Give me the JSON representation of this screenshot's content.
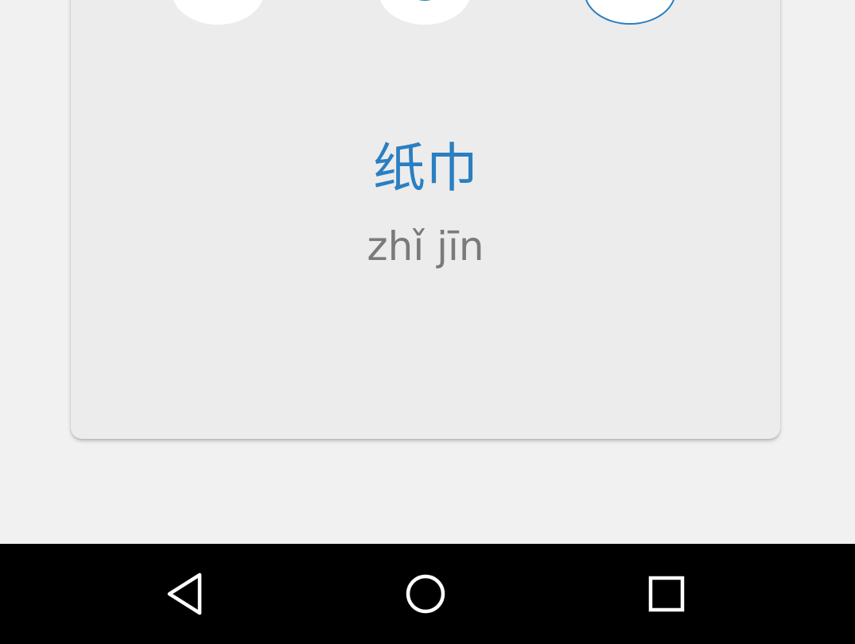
{
  "card": {
    "word": "纸巾",
    "pinyin": "zhǐ jīn"
  },
  "options": [
    {
      "selected": false
    },
    {
      "selected": false
    },
    {
      "selected": true
    }
  ],
  "navbar": {
    "icons": [
      "back-icon",
      "home-icon",
      "recent-apps-icon"
    ]
  },
  "colors": {
    "accent": "#2a7fc1",
    "pinyin": "#7a7a7a",
    "background": "#f1f1f1",
    "card": "#ececec",
    "navbar": "#000000"
  }
}
